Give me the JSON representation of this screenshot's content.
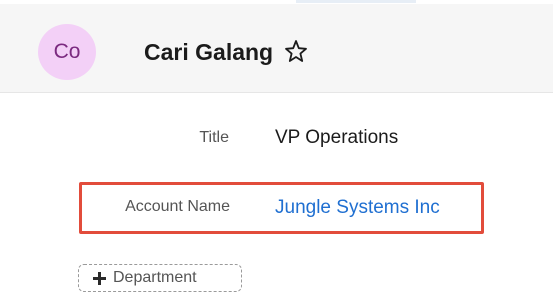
{
  "header": {
    "avatar_initials": "Co",
    "record_name": "Cari Galang",
    "favorite_icon": "star-outline-icon"
  },
  "fields": {
    "title": {
      "label": "Title",
      "value": "VP Operations"
    },
    "account_name": {
      "label": "Account Name",
      "value": "Jungle Systems Inc"
    }
  },
  "actions": {
    "add_department_label": "Department",
    "add_icon": "plus-icon"
  },
  "colors": {
    "avatar_bg": "#f3d0f7",
    "avatar_text": "#7b2a80",
    "link": "#1f6fd1",
    "highlight": "#e24c3b"
  }
}
